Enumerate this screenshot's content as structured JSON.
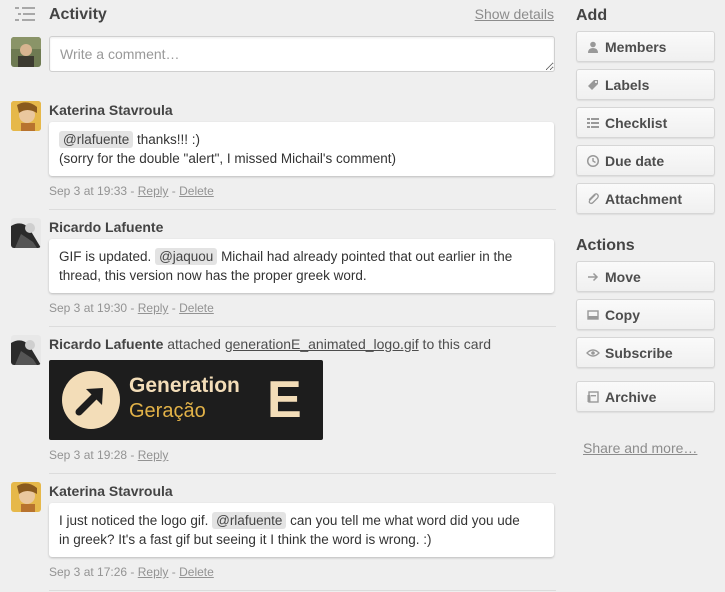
{
  "activity": {
    "title": "Activity",
    "show_details": "Show details",
    "comment_placeholder": "Write a comment…"
  },
  "actions": [
    {
      "author": "Katerina Stavroula",
      "mention": "@rlafuente",
      "text_after_mention": " thanks!!! :)",
      "line2": "(sorry for the double \"alert\", I missed Michail's comment)",
      "time": "Sep 3 at 19:33",
      "reply": "Reply",
      "delete": "Delete"
    },
    {
      "author": "Ricardo Lafuente",
      "text_before_mention": "GIF is updated. ",
      "mention": "@jaquou",
      "text_after_mention": " Michail had already pointed that out earlier in the",
      "line2": "thread, this version now has the proper greek word.",
      "time": "Sep 3 at 19:30",
      "reply": "Reply",
      "delete": "Delete"
    },
    {
      "author": "Ricardo Lafuente",
      "verb": " attached ",
      "attachment_name": "generationE_animated_logo.gif",
      "suffix": " to this card",
      "gif_line1": "Generation",
      "gif_line2": "Geração",
      "gif_letter": "E",
      "time": "Sep 3 at 19:28",
      "reply": "Reply"
    },
    {
      "author": "Katerina Stavroula",
      "text_before_mention": "I just noticed the logo gif. ",
      "mention": "@rlafuente",
      "text_after_mention": " can you tell me what word did you ude",
      "line2": "in greek? It's a fast gif but seeing it I think the word is wrong. :)",
      "time": "Sep 3 at 17:26",
      "reply": "Reply",
      "delete": "Delete"
    }
  ],
  "meta_separator": " - ",
  "sidebar": {
    "add_heading": "Add",
    "add_buttons": [
      "Members",
      "Labels",
      "Checklist",
      "Due date",
      "Attachment"
    ],
    "actions_heading": "Actions",
    "action_buttons": [
      "Move",
      "Copy",
      "Subscribe",
      "Archive"
    ],
    "share": "Share and more…"
  },
  "colors": {
    "background": "#efefef",
    "gif_background": "#1d1d1d",
    "gif_accent": "#f3ddb8",
    "gif_text_yellow": "#e2b248"
  }
}
